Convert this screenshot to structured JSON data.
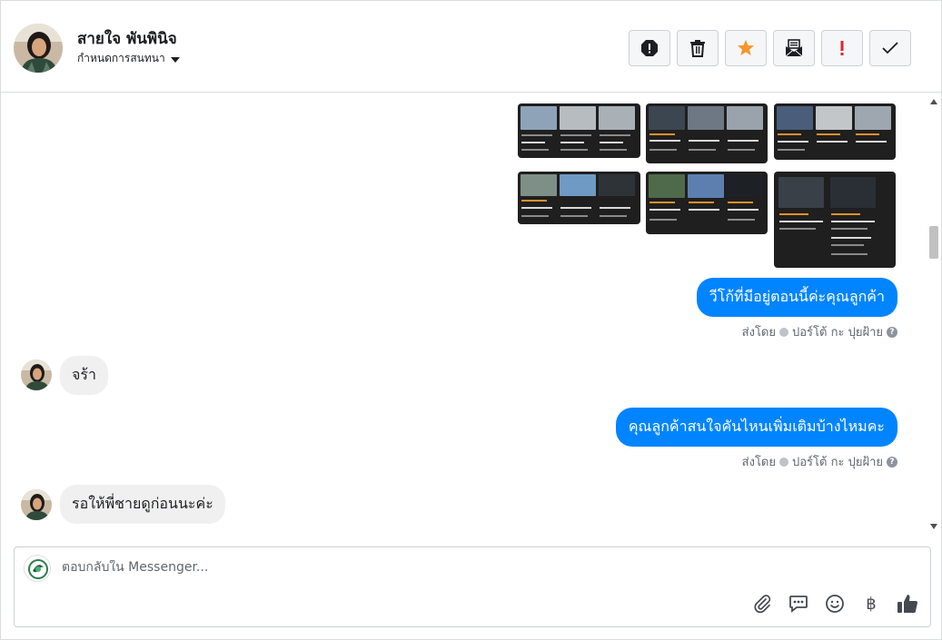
{
  "header": {
    "contact_name": "สายใจ พันพินิจ",
    "assign_label": "กำหนดการสนทนา",
    "actions": [
      {
        "name": "spam-icon",
        "color": "#1c1e21"
      },
      {
        "name": "trash-icon",
        "color": "#1c1e21"
      },
      {
        "name": "star-icon",
        "color": "#f5952b"
      },
      {
        "name": "mark-unread-icon",
        "color": "#1c1e21"
      },
      {
        "name": "important-icon",
        "color": "#e0232e"
      },
      {
        "name": "done-check-icon",
        "color": "#1c1e21"
      }
    ]
  },
  "messages": [
    {
      "from": "page",
      "text": "วีโก้ที่มีอยู่ตอนนี้ค่ะคุณลูกค้า",
      "sent_by_prefix": "ส่งโดย",
      "sent_by_name": "ปอร์โต้ กะ ปุยฝ้าย"
    },
    {
      "from": "customer",
      "text": "จร้า"
    },
    {
      "from": "page",
      "text": "คุณลูกค้าสนใจคันไหนเพิ่มเติมบ้างไหมคะ",
      "sent_by_prefix": "ส่งโดย",
      "sent_by_name": "ปอร์โต้ กะ ปุยฝ้าย"
    },
    {
      "from": "customer",
      "text": "รอให้พี่ชายดูก่อนนะค่ะ"
    }
  ],
  "composer": {
    "placeholder": "ตอบกลับใน Messenger...",
    "tools": [
      "attachment-icon",
      "saved-reply-icon",
      "emoji-icon",
      "payment-baht-icon",
      "like-thumb-icon"
    ],
    "baht_symbol": "฿"
  },
  "colors": {
    "accent": "#0084ff",
    "incoming_bubble": "#f0f0f0",
    "border": "#dadde1"
  }
}
